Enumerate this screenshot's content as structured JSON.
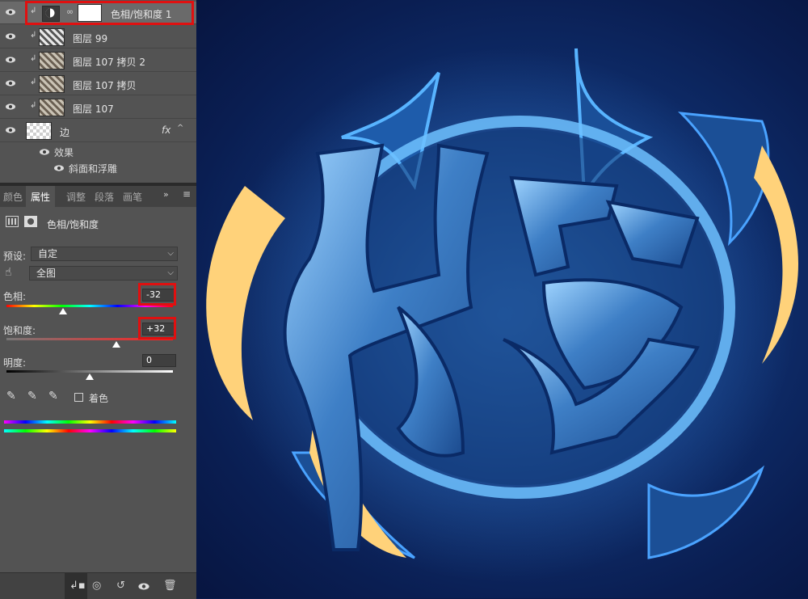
{
  "layers": [
    {
      "name": "色相/饱和度 1",
      "type": "adjustment",
      "selected": true
    },
    {
      "name": "图层 99",
      "type": "texture"
    },
    {
      "name": "图层 107 拷贝 2",
      "type": "texture"
    },
    {
      "name": "图层 107 拷贝",
      "type": "texture"
    },
    {
      "name": "图层 107",
      "type": "texture"
    },
    {
      "name": "边",
      "type": "shape",
      "fx": "fx"
    }
  ],
  "effects": {
    "label": "效果",
    "bevel": "斜面和浮雕"
  },
  "panel_tabs": [
    "颜色",
    "属性",
    "调整",
    "段落",
    "画笔"
  ],
  "active_tab": "属性",
  "adjustment_title": "色相/饱和度",
  "preset": {
    "label": "预设:",
    "value": "自定"
  },
  "range": {
    "value": "全图"
  },
  "hue": {
    "label": "色相:",
    "value": "-32",
    "level": 0.34
  },
  "saturation": {
    "label": "饱和度:",
    "value": "+32",
    "level": 0.66
  },
  "lightness": {
    "label": "明度:",
    "value": "0",
    "level": 0.5
  },
  "colorize_label": "着色",
  "colors": {
    "highlight": "#e01010",
    "panel": "#535353",
    "accent_art": "#ffd27a"
  }
}
